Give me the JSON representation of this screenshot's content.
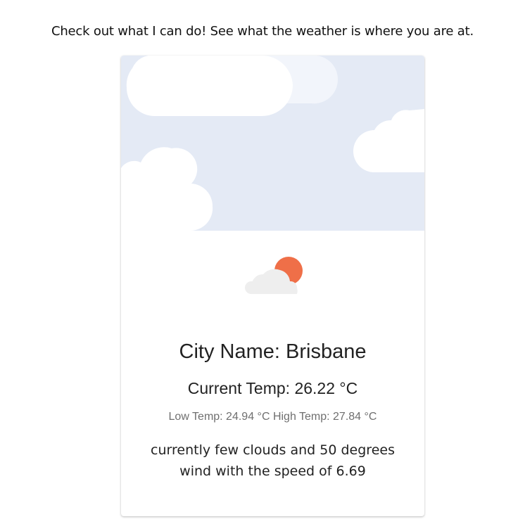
{
  "intro_text": "Check out what I can do! See what the weather is where you are at.",
  "weather_card": {
    "icon": "partly-cloudy-icon",
    "city_label": "City Name: Brisbane",
    "current_temp_label": "Current Temp: 26.22 °C",
    "low_high_label": "Low Temp: 24.94 °C High Temp: 27.84 °C",
    "description": "currently few clouds and 50 degrees wind with the speed of 6.69"
  },
  "colors": {
    "sky_background": "#e4eaf5",
    "cloud": "#ffffff",
    "sun": "#ef6f48",
    "icon_cloud": "#eeeeee"
  }
}
